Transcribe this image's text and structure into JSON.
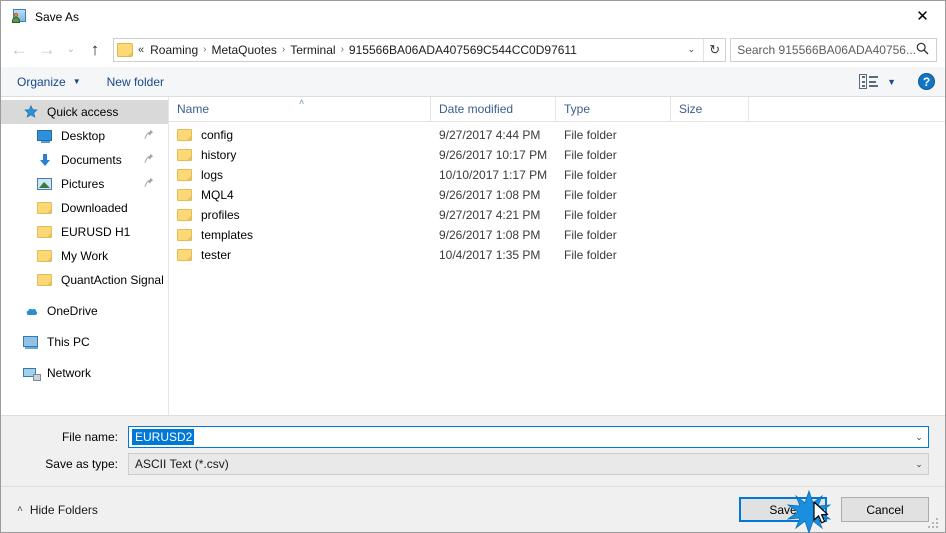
{
  "window": {
    "title": "Save As",
    "title_icon": "save-as-app-icon",
    "close_label": "✕"
  },
  "nav": {
    "back_icon": "←",
    "forward_icon": "→",
    "recent_icon": "⌄",
    "up_icon": "↑",
    "refresh_icon": "↻",
    "dropdown_icon": "⌄"
  },
  "address": {
    "lead": "«",
    "separator": "›",
    "crumbs": [
      "Roaming",
      "MetaQuotes",
      "Terminal",
      "915566BA06ADA407569C544CC0D97611"
    ]
  },
  "search": {
    "placeholder": "Search 915566BA06ADA40756...",
    "icon": "⚲"
  },
  "toolbar": {
    "organize_label": "Organize",
    "organize_caret": "▼",
    "new_folder_label": "New folder",
    "view_caret": "▼",
    "help_label": "?"
  },
  "sidebar": {
    "items": [
      {
        "label": "Quick access",
        "icon": "star-icon",
        "selected": true,
        "indent": false,
        "pinned": false
      },
      {
        "label": "Desktop",
        "icon": "desktop-icon",
        "selected": false,
        "indent": true,
        "pinned": true
      },
      {
        "label": "Documents",
        "icon": "download-arrow-icon",
        "selected": false,
        "indent": true,
        "pinned": true
      },
      {
        "label": "Pictures",
        "icon": "picture-icon",
        "selected": false,
        "indent": true,
        "pinned": true
      },
      {
        "label": "Downloaded",
        "icon": "folder-icon",
        "selected": false,
        "indent": true,
        "pinned": false
      },
      {
        "label": "EURUSD H1",
        "icon": "folder-icon",
        "selected": false,
        "indent": true,
        "pinned": false
      },
      {
        "label": "My Work",
        "icon": "folder-icon",
        "selected": false,
        "indent": true,
        "pinned": false
      },
      {
        "label": "QuantAction Signal",
        "icon": "folder-icon",
        "selected": false,
        "indent": true,
        "pinned": false
      },
      {
        "label": "OneDrive",
        "icon": "cloud-icon",
        "selected": false,
        "indent": false,
        "pinned": false,
        "gap_before": true
      },
      {
        "label": "This PC",
        "icon": "computer-icon",
        "selected": false,
        "indent": false,
        "pinned": false,
        "gap_before": true
      },
      {
        "label": "Network",
        "icon": "network-icon",
        "selected": false,
        "indent": false,
        "pinned": false,
        "gap_before": true
      }
    ],
    "pin_icon": "ⴀ"
  },
  "filelist": {
    "columns": [
      "Name",
      "Date modified",
      "Type",
      "Size"
    ],
    "sort_indicator": "˄",
    "rows": [
      {
        "name": "config",
        "date": "9/27/2017 4:44 PM",
        "type": "File folder",
        "size": ""
      },
      {
        "name": "history",
        "date": "9/26/2017 10:17 PM",
        "type": "File folder",
        "size": ""
      },
      {
        "name": "logs",
        "date": "10/10/2017 1:17 PM",
        "type": "File folder",
        "size": ""
      },
      {
        "name": "MQL4",
        "date": "9/26/2017 1:08 PM",
        "type": "File folder",
        "size": ""
      },
      {
        "name": "profiles",
        "date": "9/27/2017 4:21 PM",
        "type": "File folder",
        "size": ""
      },
      {
        "name": "templates",
        "date": "9/26/2017 1:08 PM",
        "type": "File folder",
        "size": ""
      },
      {
        "name": "tester",
        "date": "10/4/2017 1:35 PM",
        "type": "File folder",
        "size": ""
      }
    ]
  },
  "form": {
    "filename_label": "File name:",
    "filename_value": "EURUSD2",
    "filetype_label": "Save as type:",
    "filetype_value": "ASCII Text (*.csv)",
    "dropdown_caret": "⌄"
  },
  "buttons": {
    "hide_folders_label": "Hide Folders",
    "hide_folders_caret": "˄",
    "save_label": "Save",
    "cancel_label": "Cancel"
  },
  "colors": {
    "accent": "#0078d7",
    "selection_bg": "#d9d9d9",
    "folder_yellow": "#fcd976",
    "header_text": "#3a5f8f",
    "help_blue": "#1275c4"
  }
}
